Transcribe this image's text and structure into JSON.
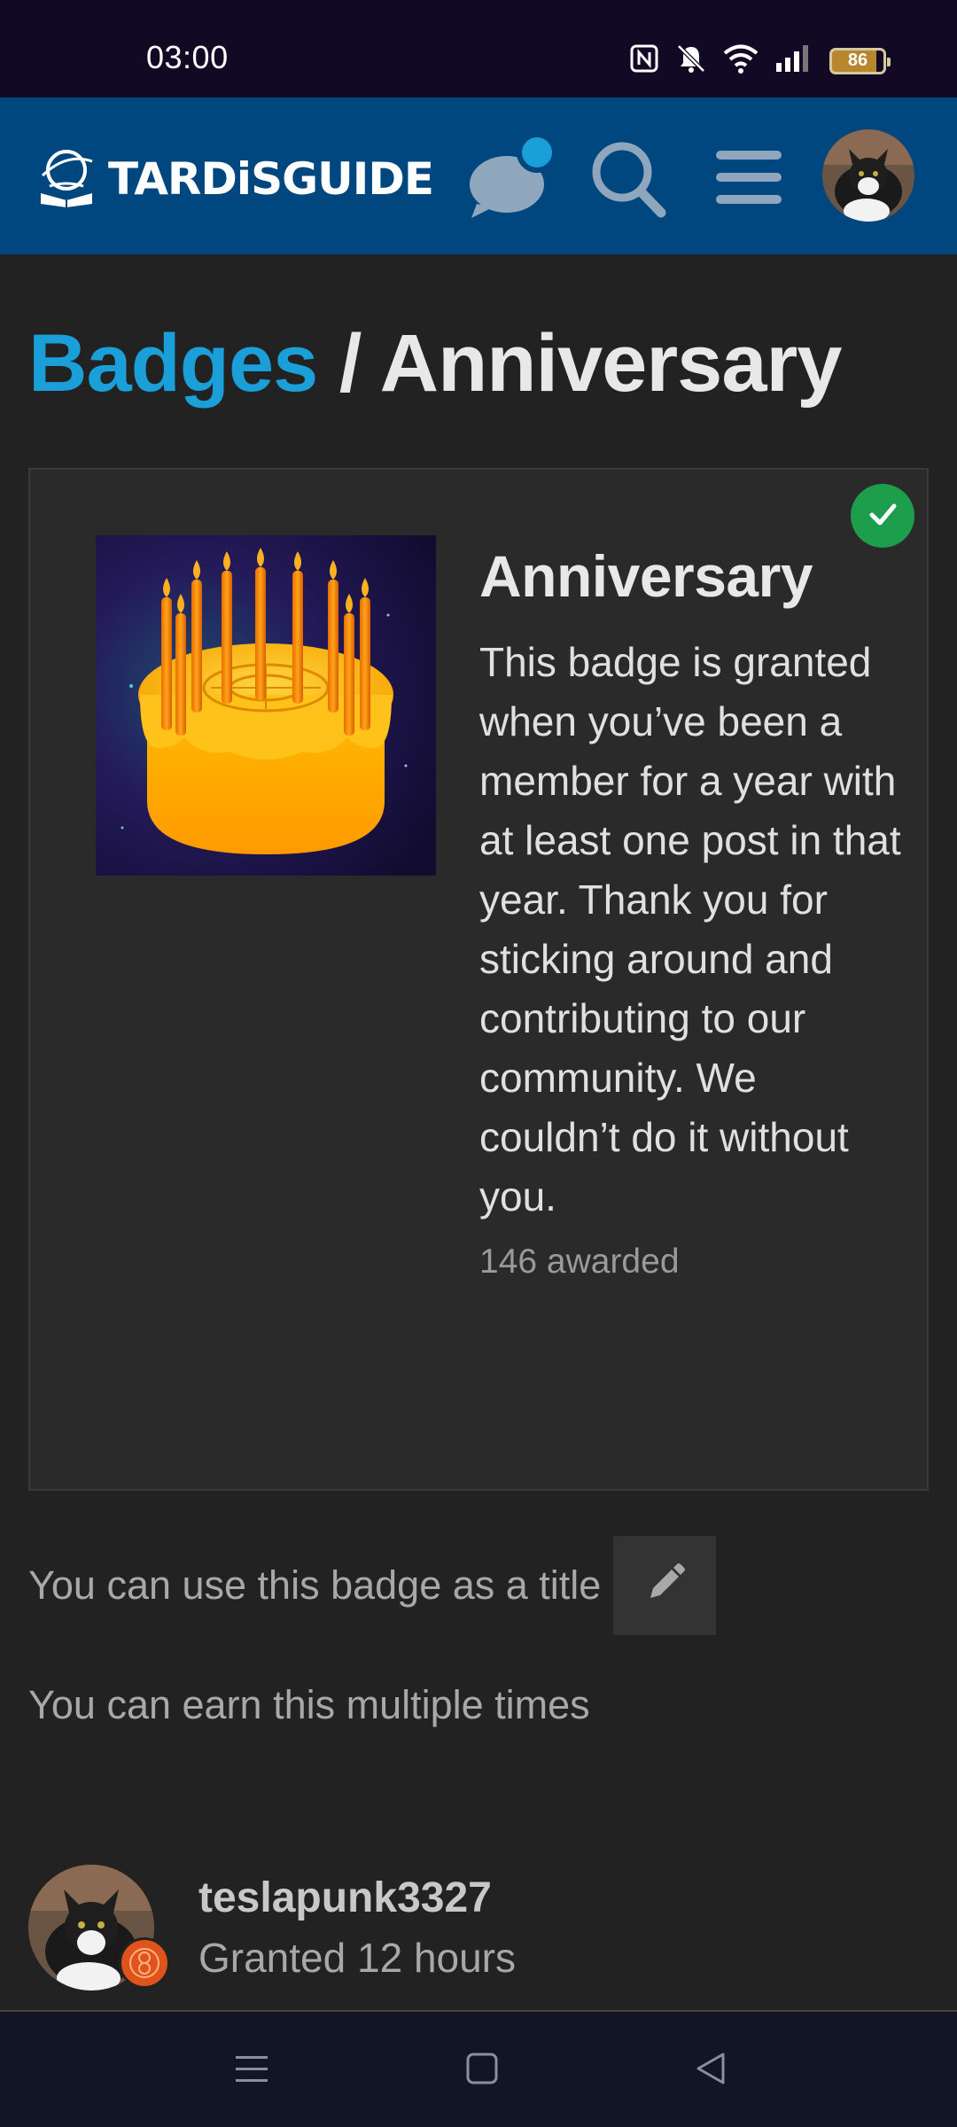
{
  "status_bar": {
    "time": "03:00",
    "battery": "86",
    "icons": [
      "nfc-icon",
      "mute-icon",
      "wifi-icon",
      "signal-icon",
      "battery-icon"
    ]
  },
  "header": {
    "logo_text": "TARDiSGUIDE",
    "icons": [
      "chat-icon",
      "search-icon",
      "menu-icon",
      "avatar"
    ],
    "accent_color": "#1a9fd8",
    "background_color": "#00467f"
  },
  "breadcrumb": {
    "parent": "Badges",
    "separator": "/",
    "current": "Anniversary"
  },
  "badge": {
    "name": "Anniversary",
    "description": "This badge is granted when you’ve been a member for a year with at least one post in that year. Thank you for sticking around and contributing to our community. We couldn’t do it without you.",
    "awarded_count": "146 awarded",
    "granted_icon": "check-icon",
    "granted_color": "#1c9e4c"
  },
  "notes": {
    "title_note": "You can use this badge as a title",
    "multi_note": "You can earn this multiple times",
    "edit_icon": "pencil-icon"
  },
  "recipient": {
    "username": "teslapunk3327",
    "granted": "Granted 12 hours"
  },
  "nav_bar": {
    "icons": [
      "recents-icon",
      "home-icon",
      "back-icon"
    ]
  }
}
